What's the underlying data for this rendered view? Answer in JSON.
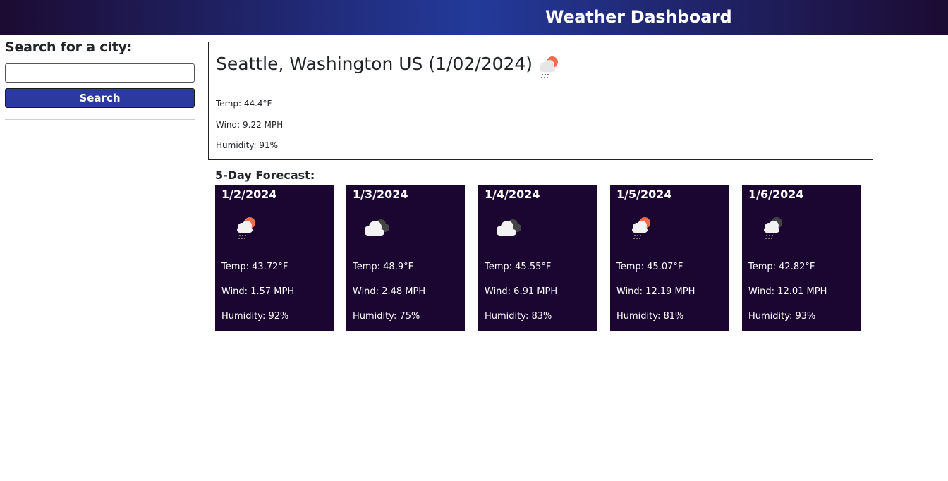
{
  "header": {
    "title": "Weather Dashboard"
  },
  "sidebar": {
    "heading": "Search for a city:",
    "search_value": "",
    "search_placeholder": "",
    "search_button": "Search"
  },
  "current": {
    "city": "Seattle, Washington US (1/02/2024)",
    "icon": "cloud-rain-sun-icon",
    "temp": "Temp: 44.4°F",
    "wind": "Wind: 9.22 MPH",
    "humidity": "Humidity: 91%"
  },
  "forecast": {
    "title": "5-Day Forecast:",
    "days": [
      {
        "date": "1/2/2024",
        "icon": "cloud-rain-sun-icon",
        "temp": "Temp: 43.72°F",
        "wind": "Wind: 1.57 MPH",
        "humidity": "Humidity: 92%"
      },
      {
        "date": "1/3/2024",
        "icon": "broken-clouds-icon",
        "temp": "Temp: 48.9°F",
        "wind": "Wind: 2.48 MPH",
        "humidity": "Humidity: 75%"
      },
      {
        "date": "1/4/2024",
        "icon": "broken-clouds-icon",
        "temp": "Temp: 45.55°F",
        "wind": "Wind: 6.91 MPH",
        "humidity": "Humidity: 83%"
      },
      {
        "date": "1/5/2024",
        "icon": "cloud-rain-sun-icon",
        "temp": "Temp: 45.07°F",
        "wind": "Wind: 12.19 MPH",
        "humidity": "Humidity: 81%"
      },
      {
        "date": "1/6/2024",
        "icon": "cloud-rain-icon",
        "temp": "Temp: 42.82°F",
        "wind": "Wind: 12.01 MPH",
        "humidity": "Humidity: 93%"
      }
    ]
  },
  "colors": {
    "header_gradient_edge": "#1c0b32",
    "header_gradient_center": "#233a9a",
    "card_background": "#1b0631",
    "button_background": "#2a3a9e",
    "sun_accent": "#ec6e4c"
  }
}
